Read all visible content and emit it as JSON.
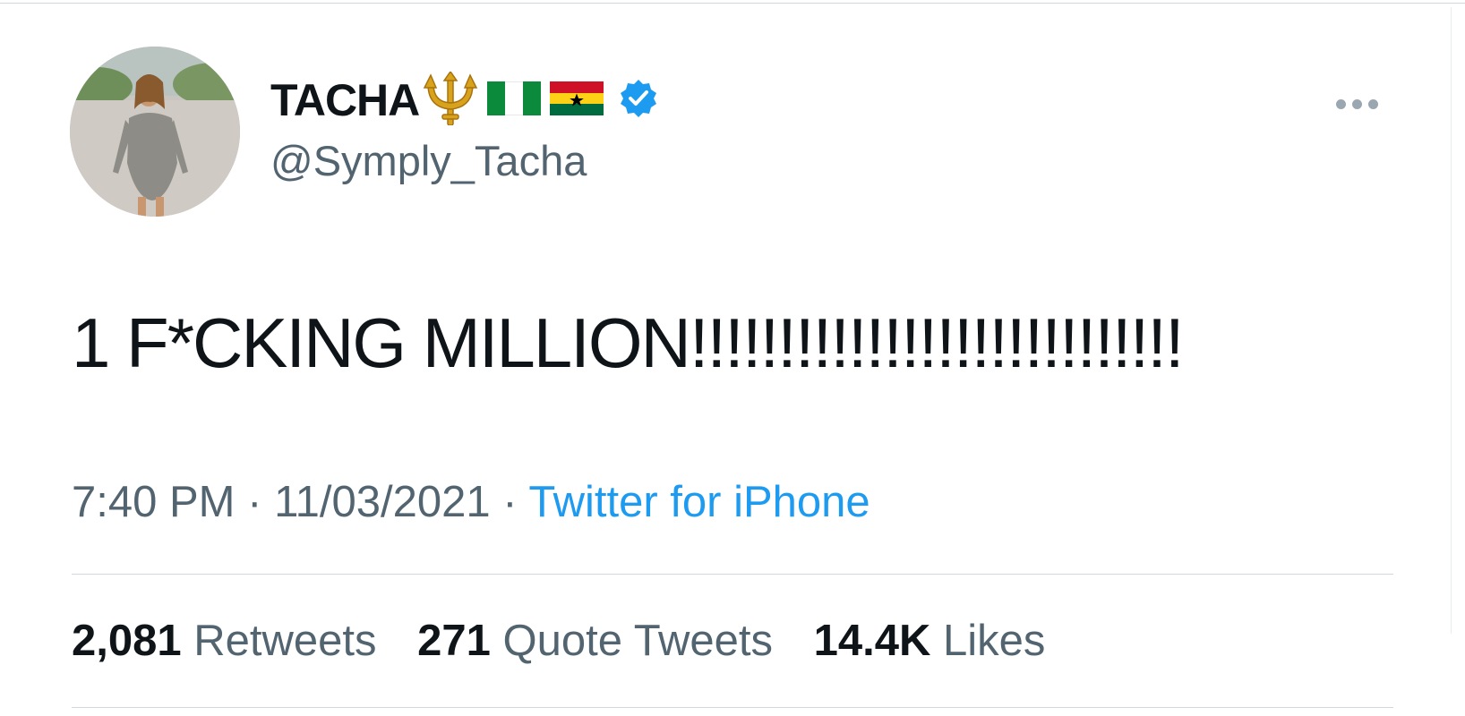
{
  "tweet": {
    "display_name": "TACHA",
    "handle": "@Symply_Tacha",
    "text": "1 F*CKING MILLION!!!!!!!!!!!!!!!!!!!!!!!!!!!!",
    "time": "7:40 PM",
    "separator": "·",
    "date": "11/03/2021",
    "source": "Twitter for iPhone",
    "name_emojis": [
      "trident-emoji",
      "nigeria-flag",
      "ghana-flag"
    ]
  },
  "stats": {
    "retweets": {
      "count": "2,081",
      "label": "Retweets"
    },
    "quotes": {
      "count": "271",
      "label": "Quote Tweets"
    },
    "likes": {
      "count": "14.4K",
      "label": "Likes"
    }
  },
  "colors": {
    "text": "#0f1419",
    "secondary": "#536471",
    "accent": "#1d9bf0",
    "divider": "#cfd9de"
  }
}
